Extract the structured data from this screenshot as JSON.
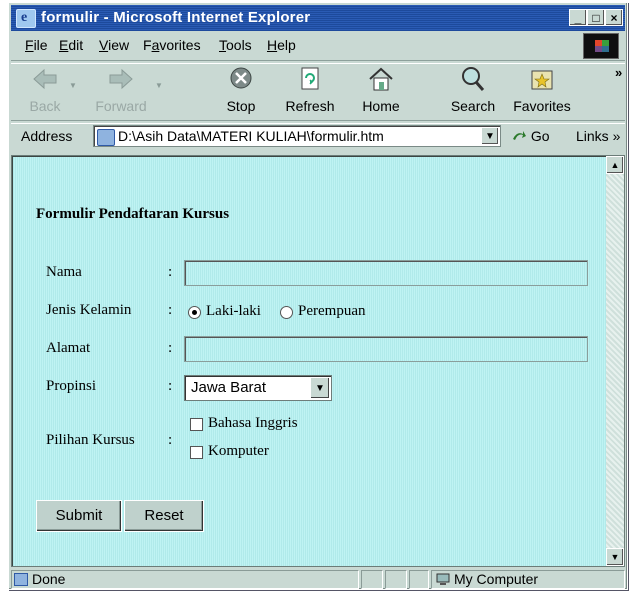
{
  "window": {
    "title": "formulir - Microsoft Internet Explorer"
  },
  "titlebar_buttons": {
    "minimize": "_",
    "maximize": "□",
    "close": "×"
  },
  "menu": [
    {
      "label": "File",
      "key": "F",
      "rest": "ile"
    },
    {
      "label": "Edit",
      "key": "E",
      "rest": "dit"
    },
    {
      "label": "View",
      "key": "V",
      "rest": "iew"
    },
    {
      "label": "Favorites",
      "key": "a",
      "pre": "F",
      "rest": "vorites"
    },
    {
      "label": "Tools",
      "key": "T",
      "rest": "ools"
    },
    {
      "label": "Help",
      "key": "H",
      "rest": "elp"
    }
  ],
  "toolbar": {
    "back": "Back",
    "forward": "Forward",
    "stop": "Stop",
    "refresh": "Refresh",
    "home": "Home",
    "search": "Search",
    "favorites": "Favorites",
    "overflow": "»"
  },
  "address": {
    "label": "Address",
    "url": "D:\\Asih Data\\MATERI KULIAH\\formulir.htm",
    "go": "Go",
    "links": "Links »"
  },
  "form": {
    "title": "Formulir Pendaftaran Kursus",
    "nama_label": "Nama",
    "nama_value": "",
    "jk_label": "Jenis Kelamin",
    "jk_options": [
      "Laki-laki",
      "Perempuan"
    ],
    "jk_selected": "Laki-laki",
    "alamat_label": "Alamat",
    "alamat_value": "",
    "propinsi_label": "Propinsi",
    "propinsi_value": "Jawa Barat",
    "kursus_label": "Pilihan Kursus",
    "kursus_options": [
      "Bahasa Inggris",
      "Komputer"
    ],
    "colon": ":",
    "submit": "Submit",
    "reset": "Reset"
  },
  "status": {
    "left": "Done",
    "zone": "My Computer"
  }
}
